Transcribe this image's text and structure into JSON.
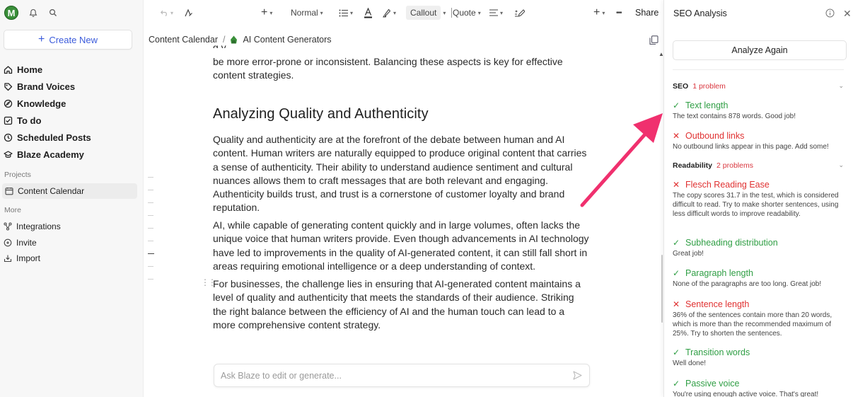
{
  "sidebar": {
    "avatar_letter": "M",
    "create_label": "Create New",
    "nav": [
      {
        "label": "Home",
        "icon": "home-icon"
      },
      {
        "label": "Brand Voices",
        "icon": "brand-icon"
      },
      {
        "label": "Knowledge",
        "icon": "knowledge-icon"
      },
      {
        "label": "To do",
        "icon": "todo-icon"
      },
      {
        "label": "Scheduled Posts",
        "icon": "clock-icon"
      },
      {
        "label": "Blaze Academy",
        "icon": "academy-icon"
      }
    ],
    "projects_label": "Projects",
    "project_item": "Content Calendar",
    "more_label": "More",
    "more_items": [
      {
        "label": "Integrations",
        "icon": "integrations-icon"
      },
      {
        "label": "Invite",
        "icon": "invite-icon"
      },
      {
        "label": "Import",
        "icon": "import-icon"
      }
    ]
  },
  "toolbar": {
    "plus": "+",
    "style": "Normal",
    "callout": "Callout",
    "quote": "Quote",
    "share": "Share",
    "more": "•••"
  },
  "breadcrumb": {
    "root": "Content Calendar",
    "separator": "/",
    "current": "AI Content Generators"
  },
  "editor": {
    "clipped_line": "g                                         y           ,                              ,",
    "para0": "be more error-prone or inconsistent. Balancing these aspects is key for effective content strategies.",
    "heading": "Analyzing Quality and Authenticity",
    "para1": "Quality and authenticity are at the forefront of the debate between human and AI content. Human writers are naturally equipped to produce original content that carries a sense of authenticity. Their ability to understand audience sentiment and cultural nuances allows them to craft messages that are both relevant and engaging. Authenticity builds trust, and trust is a cornerstone of customer loyalty and brand reputation.",
    "para2": "AI, while capable of generating content quickly and in large volumes, often lacks the unique voice that human writers provide. Even though advancements in AI technology have led to improvements in the quality of AI-generated content, it can still fall short in areas requiring emotional intelligence or a deep understanding of context.",
    "para3": "For businesses, the challenge lies in ensuring that AI-generated content maintains a level of quality and authenticity that meets the standards of their audience. Striking the right balance between the efficiency of AI and the human touch can lead to a more comprehensive content strategy.",
    "ask_placeholder": "Ask Blaze to edit or generate..."
  },
  "panel": {
    "title": "SEO Analysis",
    "analyze_label": "Analyze Again",
    "seo_label": "SEO",
    "seo_problems": "1 problem",
    "readability_label": "Readability",
    "readability_problems": "2 problems",
    "checks": [
      {
        "status": "ok",
        "title": "Text length",
        "desc": "The text contains 878 words. Good job!"
      },
      {
        "status": "bad",
        "title": "Outbound links",
        "desc": "No outbound links appear in this page. Add some!"
      },
      {
        "status": "bad",
        "title": "Flesch Reading Ease",
        "desc": "The copy scores 31.7 in the test, which is considered difficult to read. Try to make shorter sentences, using less difficult words to improve readability."
      },
      {
        "status": "ok",
        "title": "Subheading distribution",
        "desc": "Great job!"
      },
      {
        "status": "ok",
        "title": "Paragraph length",
        "desc": "None of the paragraphs are too long. Great job!"
      },
      {
        "status": "bad",
        "title": "Sentence length",
        "desc": "36% of the sentences contain more than 20 words, which is more than the recommended maximum of 25%. Try to shorten the sentences."
      },
      {
        "status": "ok",
        "title": "Transition words",
        "desc": "Well done!"
      },
      {
        "status": "ok",
        "title": "Passive voice",
        "desc": "You're using enough active voice. That's great!"
      }
    ]
  },
  "colors": {
    "ok": "#2f9e44",
    "bad": "#e03131",
    "accent": "#3b5bdb",
    "arrow": "#f0306e",
    "avatar": "#3a8f3a"
  }
}
